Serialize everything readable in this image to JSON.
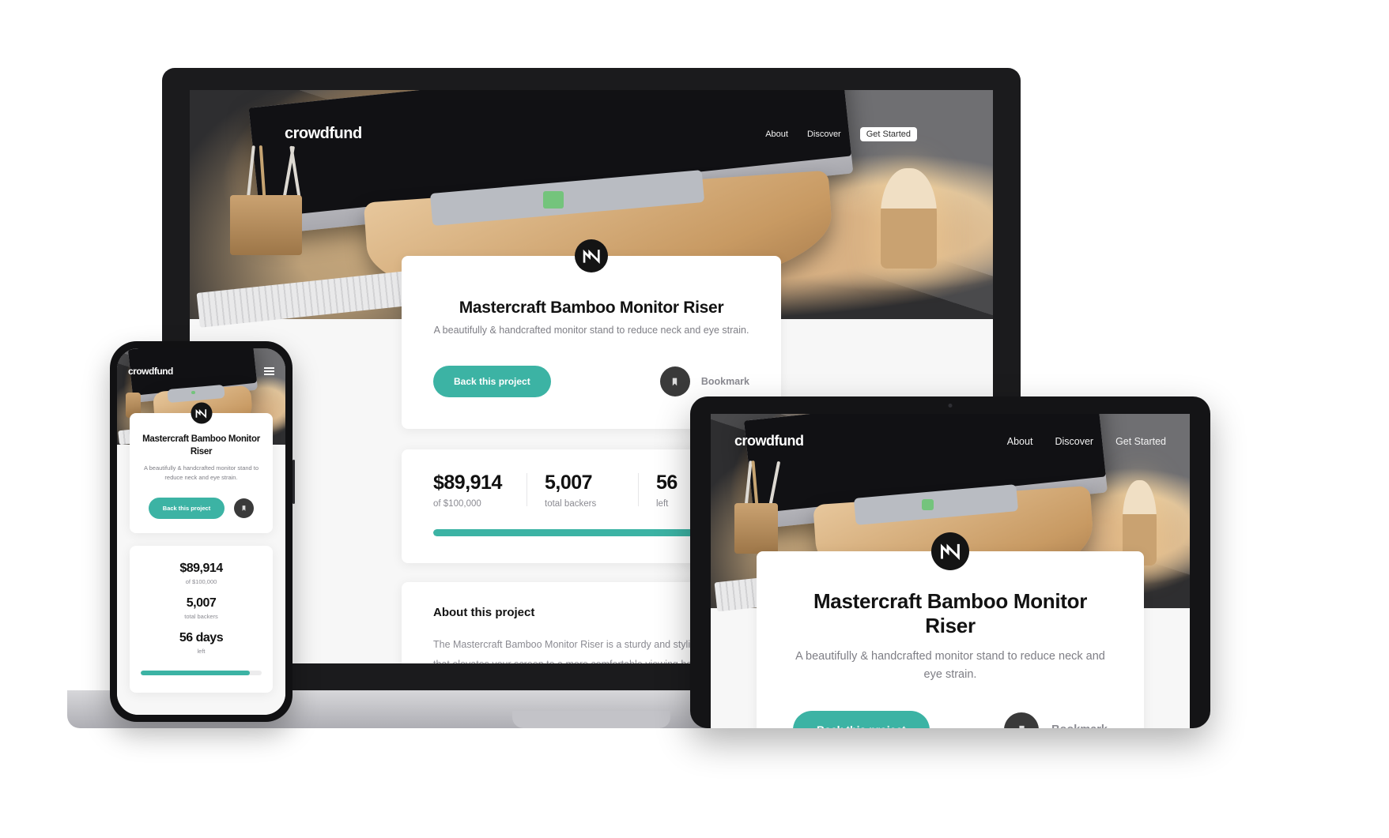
{
  "brand": "crowdfund",
  "nav": {
    "about": "About",
    "discover": "Discover",
    "get_started": "Get Started",
    "menu_icon": "hamburger-menu-icon"
  },
  "project": {
    "title": "Mastercraft Bamboo Monitor Riser",
    "tagline": "A beautifully & handcrafted monitor stand to reduce neck and eye strain.",
    "back_button": "Back this project",
    "bookmark_label": "Bookmark",
    "bookmark_icon": "bookmark-icon",
    "logo_icon": "crowdfund-mastercraft-logo-icon"
  },
  "stats": {
    "amount_value": "$89,914",
    "amount_sub": "of $100,000",
    "backers_value": "5,007",
    "backers_sub": "total backers",
    "days_value": "56",
    "days_value_mobile": "56 days",
    "days_sub": "left",
    "progress_percent": 89.914
  },
  "about": {
    "heading": "About this project",
    "body": "The Mastercraft Bamboo Monitor Riser is a sturdy and stylish platform that elevates your screen to a more comfortable viewing height. Placing your monitor at eye level has the potential to improve your posture and make you more comfortable while at work, helping you stay focused on the task at hand."
  },
  "colors": {
    "accent": "#3cb3a4",
    "dark": "#141414",
    "muted": "#8b8b92",
    "page_bg": "#f7f7f7"
  },
  "devices": {
    "laptop": "laptop-device-mockup",
    "phone": "phone-device-mockup",
    "tablet": "tablet-device-mockup"
  }
}
